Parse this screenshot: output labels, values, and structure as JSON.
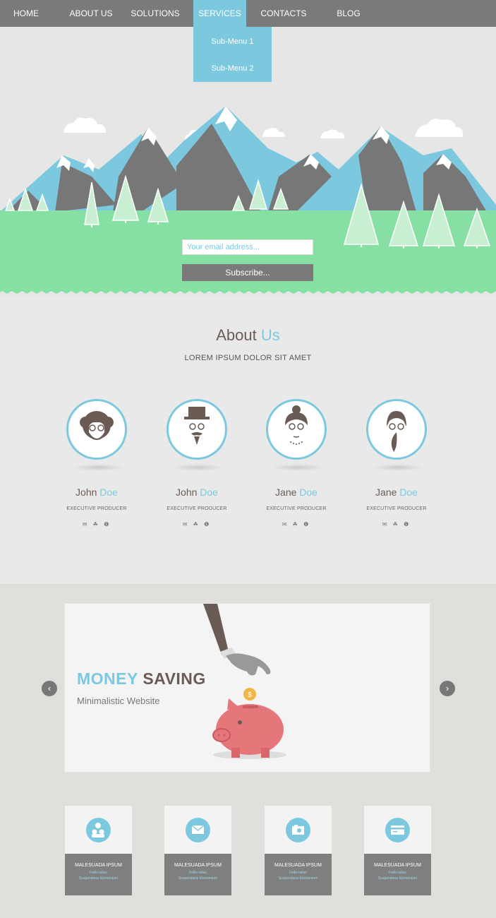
{
  "nav": {
    "items": [
      {
        "label": "HOME"
      },
      {
        "label": "ABOUT US"
      },
      {
        "label": "SOLUTIONS"
      },
      {
        "label": "SERVICES"
      },
      {
        "label": "CONTACTS"
      },
      {
        "label": "BLOG"
      }
    ],
    "active": "SERVICES",
    "submenu": [
      {
        "label": "Sub-Menu 1"
      },
      {
        "label": "Sub-Menu 2"
      }
    ]
  },
  "hero": {
    "email_placeholder": "Your email address...",
    "subscribe_label": "Subscribe..."
  },
  "about": {
    "title_a": "About",
    "title_b": "Us",
    "subtitle": "LOREM IPSUM DOLOR SIT AMET",
    "members": [
      {
        "first": "John",
        "last": "Doe",
        "role": "EXECUTIVE PRODUCER"
      },
      {
        "first": "John",
        "last": "Doe",
        "role": "EXECUTIVE PRODUCER"
      },
      {
        "first": "Jane",
        "last": "Doe",
        "role": "EXECUTIVE PRODUCER"
      },
      {
        "first": "Jane",
        "last": "Doe",
        "role": "EXECUTIVE PRODUCER"
      }
    ],
    "social_icons": "✉ ☘ ❶"
  },
  "slider": {
    "title_a": "MONEY",
    "title_b": "SAVING",
    "subtitle": "Minimalistic Website",
    "prev_icon": "‹",
    "next_icon": "›"
  },
  "features": [
    {
      "icon": "users-icon",
      "title": "MALESUADA IPSUM",
      "line1": "Fellis tellus",
      "line2": "Suspendisse Elementum"
    },
    {
      "icon": "mail-icon",
      "title": "MALESUADA IPSUM",
      "line1": "Fellis tellus",
      "line2": "Suspendisse Elementum"
    },
    {
      "icon": "camera-icon",
      "title": "MALESUADA IPSUM",
      "line1": "Fellis tellus",
      "line2": "Suspendisse Elementum"
    },
    {
      "icon": "credit-card-icon",
      "title": "MALESUADA IPSUM",
      "line1": "Fellis tellus",
      "line2": "Suspendisse Elementum"
    }
  ],
  "colors": {
    "accent": "#7cc9df",
    "nav": "#7a7a7a",
    "grass": "#86e0a4",
    "mountain_gray": "#777777",
    "mountain_blue": "#7cc9df",
    "text_dark": "#6b5b55"
  }
}
